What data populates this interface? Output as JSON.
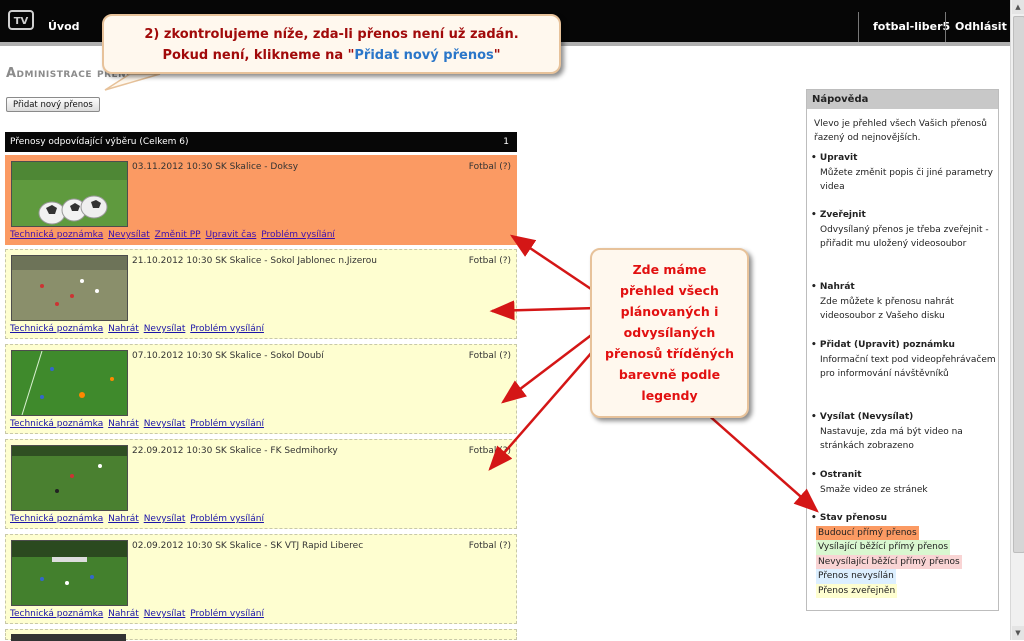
{
  "topbar": {
    "logo": "TV",
    "home": "Úvod",
    "user": "fotbal-liber5",
    "logout": "Odhlásit"
  },
  "page": {
    "title": "Administrace přenosů",
    "add_button": "Přidat nový přenos"
  },
  "list": {
    "header": "Přenosy odpovídající výběru (Celkem 6)",
    "page": "1",
    "entries": [
      {
        "title": "03.11.2012 10:30 SK Skalice - Doksy",
        "sport": "Fotbal (?)",
        "links": [
          "Technická poznámka",
          "Nevysílat",
          "Změnit PP",
          "Upravit čas",
          "Problém vysílání"
        ]
      },
      {
        "title": "21.10.2012 10:30 SK Skalice - Sokol Jablonec n.Jizerou",
        "sport": "Fotbal (?)",
        "links": [
          "Technická poznámka",
          "Nahrát",
          "Nevysílat",
          "Problém vysílání"
        ]
      },
      {
        "title": "07.10.2012 10:30 SK Skalice - Sokol Doubí",
        "sport": "Fotbal (?)",
        "links": [
          "Technická poznámka",
          "Nahrát",
          "Nevysílat",
          "Problém vysílání"
        ]
      },
      {
        "title": "22.09.2012 10:30 SK Skalice - FK Sedmihorky",
        "sport": "Fotbal (?)",
        "links": [
          "Technická poznámka",
          "Nahrát",
          "Nevysílat",
          "Problém vysílání"
        ]
      },
      {
        "title": "02.09.2012 10:30 SK Skalice - SK VTJ Rapid Liberec",
        "sport": "Fotbal (?)",
        "links": [
          "Technická poznámka",
          "Nahrát",
          "Nevysílat",
          "Problém vysílání"
        ]
      }
    ]
  },
  "help": {
    "title": "Nápověda",
    "intro": "Vlevo je přehled všech Vašich přenosů řazený od nejnovějších.",
    "items": [
      {
        "title": "Upravit",
        "text": "Můžete změnit popis či jiné parametry videa"
      },
      {
        "title": "Zveřejnit",
        "text": "Odvysílaný přenos je třeba zveřejnit - přiřadit mu uložený videosoubor"
      },
      {
        "title": "Nahrát",
        "text": "Zde můžete k přenosu nahrát videosoubor z Vašeho disku"
      },
      {
        "title": "Přidat (Upravit) poznámku",
        "text": "Informační text pod videopřehrávačem pro informování návštěvníků"
      },
      {
        "title": "Vysílat (Nevysílat)",
        "text": "Nastavuje, zda má být video na stránkách zobrazeno"
      },
      {
        "title": "Ostranit",
        "text": "Smaže video ze stránek"
      }
    ],
    "legend_title": "Stav přenosu",
    "legend": [
      {
        "label": "Budoucí přímý přenos",
        "color": "#fb9a63"
      },
      {
        "label": "Vysílající běžící přímý přenos",
        "color": "#d9f7d0"
      },
      {
        "label": "Nevysílající běžící přímý přenos",
        "color": "#f9d4d4"
      },
      {
        "label": "Přenos nevysílán",
        "color": "#dcefff"
      },
      {
        "label": "Přenos zveřejněn",
        "color": "#fefed0"
      }
    ]
  },
  "callouts": {
    "top_line1": "2) zkontrolujeme níže, zda-li přenos není už zadán.",
    "top_line2_a": "Pokud není, klikneme na \"",
    "top_line2_link": "Přidat nový přenos",
    "top_line2_b": "\"",
    "mid": [
      "Zde máme",
      "přehled všech",
      "plánovaných i",
      "odvysílaných",
      "přenosů tříděných",
      "barevně podle",
      "legendy"
    ]
  },
  "colors": {
    "accent_red": "#e21010",
    "future_live": "#fb9a63",
    "published": "#fefed0"
  }
}
